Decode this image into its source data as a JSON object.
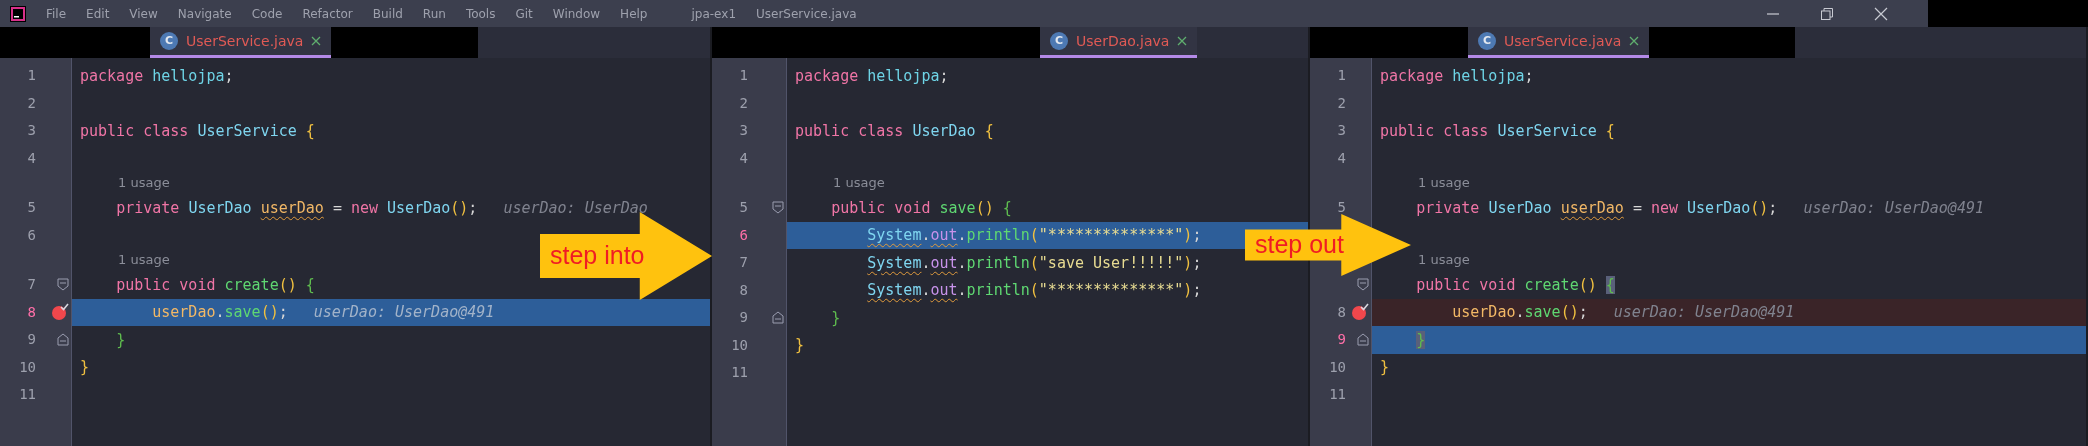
{
  "menu_bar": {
    "items": [
      "File",
      "Edit",
      "View",
      "Navigate",
      "Code",
      "Refactor",
      "Build",
      "Run",
      "Tools",
      "Git",
      "Window",
      "Help"
    ],
    "project": "jpa-ex1",
    "file": "UserService.java"
  },
  "editors": [
    {
      "tab": {
        "icon_letter": "C",
        "label": "UserService.java",
        "selected": true
      },
      "lines": [
        {
          "number": "1",
          "execution": false,
          "breakpoint": false,
          "tokens": [
            {
              "text": "package ",
              "kind": "keyword"
            },
            {
              "text": "hellojpa",
              "kind": "package"
            },
            {
              "text": ";",
              "kind": "plain"
            }
          ]
        },
        {
          "number": "2",
          "execution": false,
          "breakpoint": false
        },
        {
          "number": "3",
          "execution": false,
          "breakpoint": false,
          "tokens": [
            {
              "text": "public class ",
              "kind": "keyword"
            },
            {
              "text": "UserService ",
              "kind": "class"
            },
            {
              "text": "{",
              "kind": "bracket"
            }
          ]
        },
        {
          "number": "4",
          "execution": false,
          "breakpoint": false
        },
        {
          "number": "5",
          "usage": "1 usage",
          "execution": false,
          "breakpoint": false,
          "hint": "userDao: UserDao",
          "tokens": [
            {
              "text": "    private ",
              "kind": "keyword"
            },
            {
              "text": "UserDao ",
              "kind": "class"
            },
            {
              "text": "userDao",
              "kind": "field",
              "warning": true
            },
            {
              "text": " = ",
              "kind": "plain"
            },
            {
              "text": "new ",
              "kind": "keyword"
            },
            {
              "text": "UserDao",
              "kind": "class"
            },
            {
              "text": "()",
              "kind": "bracket"
            },
            {
              "text": ";",
              "kind": "plain"
            }
          ]
        },
        {
          "number": "6",
          "execution": false,
          "breakpoint": false
        },
        {
          "number": "7",
          "usage": "1 usage",
          "execution": false,
          "breakpoint": false,
          "fold_start": true,
          "tokens": [
            {
              "text": "    public void ",
              "kind": "keyword"
            },
            {
              "text": "create",
              "kind": "method"
            },
            {
              "text": "() ",
              "kind": "bracket"
            },
            {
              "text": "{",
              "kind": "bracket2"
            }
          ]
        },
        {
          "number": "8",
          "execution": true,
          "breakpoint": true,
          "hint": "userDao: UserDao@491",
          "tokens": [
            {
              "text": "        userDao",
              "kind": "field"
            },
            {
              "text": ".",
              "kind": "plain"
            },
            {
              "text": "save",
              "kind": "method"
            },
            {
              "text": "()",
              "kind": "bracket"
            },
            {
              "text": ";",
              "kind": "plain"
            }
          ]
        },
        {
          "number": "9",
          "execution": false,
          "breakpoint": false,
          "fold_end": true,
          "tokens": [
            {
              "text": "    }",
              "kind": "bracket2"
            }
          ]
        },
        {
          "number": "10",
          "execution": false,
          "breakpoint": false,
          "tokens": [
            {
              "text": "}",
              "kind": "bracket"
            }
          ]
        },
        {
          "number": "11",
          "execution": false,
          "breakpoint": false
        }
      ]
    },
    {
      "tab": {
        "icon_letter": "C",
        "label": "UserDao.java",
        "selected": true
      },
      "lines": [
        {
          "number": "1",
          "execution": false,
          "breakpoint": false,
          "tokens": [
            {
              "text": "package ",
              "kind": "keyword"
            },
            {
              "text": "hellojpa",
              "kind": "package"
            },
            {
              "text": ";",
              "kind": "plain"
            }
          ]
        },
        {
          "number": "2",
          "execution": false,
          "breakpoint": false
        },
        {
          "number": "3",
          "execution": false,
          "breakpoint": false,
          "tokens": [
            {
              "text": "public class ",
              "kind": "keyword"
            },
            {
              "text": "UserDao ",
              "kind": "class"
            },
            {
              "text": "{",
              "kind": "bracket"
            }
          ]
        },
        {
          "number": "4",
          "execution": false,
          "breakpoint": false
        },
        {
          "number": "5",
          "usage": "1 usage",
          "execution": false,
          "breakpoint": false,
          "fold_start": true,
          "tokens": [
            {
              "text": "    public void ",
              "kind": "keyword"
            },
            {
              "text": "save",
              "kind": "method"
            },
            {
              "text": "() ",
              "kind": "bracket"
            },
            {
              "text": "{",
              "kind": "bracket2"
            }
          ]
        },
        {
          "number": "6",
          "execution": true,
          "breakpoint": false,
          "tokens": [
            {
              "text": "        System",
              "kind": "class",
              "warning": true
            },
            {
              "text": ".",
              "kind": "plain"
            },
            {
              "text": "out",
              "kind": "static_field",
              "warning": true
            },
            {
              "text": ".",
              "kind": "plain"
            },
            {
              "text": "println",
              "kind": "method"
            },
            {
              "text": "(",
              "kind": "bracket"
            },
            {
              "text": "\"**************\"",
              "kind": "string"
            },
            {
              "text": ")",
              "kind": "bracket"
            },
            {
              "text": ";",
              "kind": "plain"
            }
          ]
        },
        {
          "number": "7",
          "execution": false,
          "breakpoint": false,
          "tokens": [
            {
              "text": "        System",
              "kind": "class",
              "warning": true
            },
            {
              "text": ".",
              "kind": "plain"
            },
            {
              "text": "out",
              "kind": "static_field",
              "warning": true
            },
            {
              "text": ".",
              "kind": "plain"
            },
            {
              "text": "println",
              "kind": "method"
            },
            {
              "text": "(",
              "kind": "bracket"
            },
            {
              "text": "\"save User!!!!!\"",
              "kind": "string"
            },
            {
              "text": ")",
              "kind": "bracket"
            },
            {
              "text": ";",
              "kind": "plain"
            }
          ]
        },
        {
          "number": "8",
          "execution": false,
          "breakpoint": false,
          "tokens": [
            {
              "text": "        System",
              "kind": "class",
              "warning": true
            },
            {
              "text": ".",
              "kind": "plain"
            },
            {
              "text": "out",
              "kind": "static_field",
              "warning": true
            },
            {
              "text": ".",
              "kind": "plain"
            },
            {
              "text": "println",
              "kind": "method"
            },
            {
              "text": "(",
              "kind": "bracket"
            },
            {
              "text": "\"**************\"",
              "kind": "string"
            },
            {
              "text": ")",
              "kind": "bracket"
            },
            {
              "text": ";",
              "kind": "plain"
            }
          ]
        },
        {
          "number": "9",
          "execution": false,
          "breakpoint": false,
          "fold_end": true,
          "tokens": [
            {
              "text": "    }",
              "kind": "bracket2"
            }
          ]
        },
        {
          "number": "10",
          "execution": false,
          "breakpoint": false,
          "tokens": [
            {
              "text": "}",
              "kind": "bracket"
            }
          ]
        },
        {
          "number": "11",
          "execution": false,
          "breakpoint": false
        }
      ]
    },
    {
      "tab": {
        "icon_letter": "C",
        "label": "UserService.java",
        "selected": true
      },
      "lines": [
        {
          "number": "1",
          "execution": false,
          "breakpoint": false,
          "tokens": [
            {
              "text": "package ",
              "kind": "keyword"
            },
            {
              "text": "hellojpa",
              "kind": "package"
            },
            {
              "text": ";",
              "kind": "plain"
            }
          ]
        },
        {
          "number": "2",
          "execution": false,
          "breakpoint": false
        },
        {
          "number": "3",
          "execution": false,
          "breakpoint": false,
          "tokens": [
            {
              "text": "public class ",
              "kind": "keyword"
            },
            {
              "text": "UserService ",
              "kind": "class"
            },
            {
              "text": "{",
              "kind": "bracket"
            }
          ]
        },
        {
          "number": "4",
          "execution": false,
          "breakpoint": false
        },
        {
          "number": "5",
          "usage": "1 usage",
          "execution": false,
          "breakpoint": false,
          "hint": "userDao: UserDao@491",
          "tokens": [
            {
              "text": "    private ",
              "kind": "keyword"
            },
            {
              "text": "UserDao ",
              "kind": "class"
            },
            {
              "text": "userDao",
              "kind": "field",
              "warning": true
            },
            {
              "text": " = ",
              "kind": "plain"
            },
            {
              "text": "new ",
              "kind": "keyword"
            },
            {
              "text": "UserDao",
              "kind": "class"
            },
            {
              "text": "()",
              "kind": "bracket"
            },
            {
              "text": ";",
              "kind": "plain"
            }
          ]
        },
        {
          "execution": false,
          "breakpoint": false
        },
        {
          "usage": "1 usage",
          "execution": false,
          "breakpoint": false,
          "fold_start": true,
          "tokens": [
            {
              "text": "    public void ",
              "kind": "keyword"
            },
            {
              "text": "create",
              "kind": "method"
            },
            {
              "text": "() ",
              "kind": "bracket"
            },
            {
              "text": "{",
              "kind": "bracket2",
              "matched": true
            }
          ]
        },
        {
          "number": "8",
          "execution": false,
          "breakpoint": true,
          "hint": "userDao: UserDao@491",
          "tokens": [
            {
              "text": "        userDao",
              "kind": "field"
            },
            {
              "text": ".",
              "kind": "plain"
            },
            {
              "text": "save",
              "kind": "method"
            },
            {
              "text": "()",
              "kind": "bracket"
            },
            {
              "text": ";",
              "kind": "plain"
            }
          ]
        },
        {
          "number": "9",
          "execution": true,
          "breakpoint": false,
          "fold_end": true,
          "tokens": [
            {
              "text": "    }",
              "kind": "bracket2",
              "matched": true
            }
          ]
        },
        {
          "number": "10",
          "execution": false,
          "breakpoint": false,
          "tokens": [
            {
              "text": "}",
              "kind": "bracket"
            }
          ]
        },
        {
          "number": "11",
          "execution": false,
          "breakpoint": false
        }
      ]
    }
  ],
  "annotations": [
    {
      "text": "step into"
    },
    {
      "text": "step out"
    }
  ]
}
